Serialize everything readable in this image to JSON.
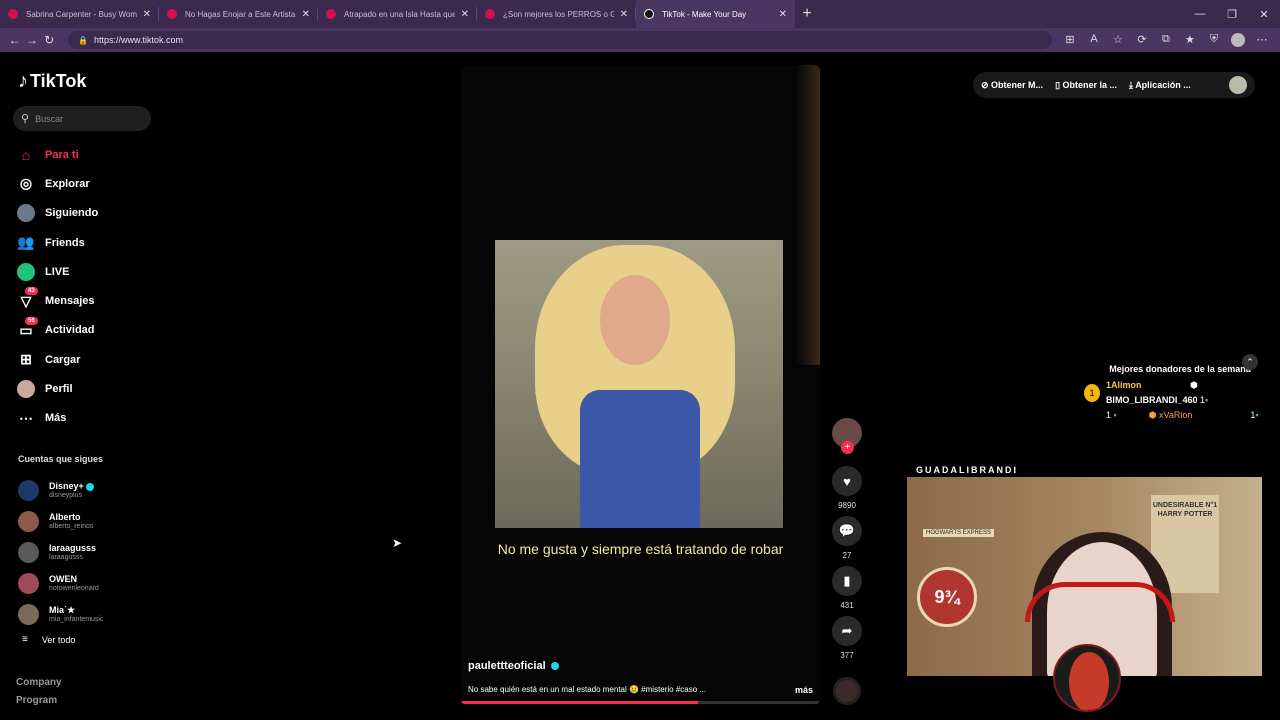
{
  "browser": {
    "tabs": [
      {
        "title": "Sabrina Carpenter - Busy Woman",
        "active": false
      },
      {
        "title": "No Hagas Enojar a Este Artista - Y",
        "active": false
      },
      {
        "title": "Atrapado en una Isla Hasta que Co",
        "active": false
      },
      {
        "title": "¿Son mejores los PERROS o GATO",
        "active": false
      },
      {
        "title": "TikTok - Make Your Day",
        "active": true
      }
    ],
    "url": "https://www.tiktok.com"
  },
  "sidebar": {
    "logo": "TikTok",
    "search_placeholder": "Buscar",
    "items": [
      {
        "label": "Para ti",
        "icon": "home-icon",
        "active": true
      },
      {
        "label": "Explorar",
        "icon": "compass-icon"
      },
      {
        "label": "Siguiendo",
        "icon": "following-avatar-icon"
      },
      {
        "label": "Friends",
        "icon": "friends-icon"
      },
      {
        "label": "LIVE",
        "icon": "live-icon"
      },
      {
        "label": "Mensajes",
        "icon": "message-icon",
        "badge": "43"
      },
      {
        "label": "Actividad",
        "icon": "activity-icon",
        "badge": "56"
      },
      {
        "label": "Cargar",
        "icon": "upload-icon"
      },
      {
        "label": "Perfil",
        "icon": "profile-avatar-icon"
      },
      {
        "label": "Más",
        "icon": "more-icon"
      }
    ],
    "following_title": "Cuentas que sigues",
    "following": [
      {
        "name": "Disney+",
        "handle": "disneyplus",
        "verified": true
      },
      {
        "name": "Alberto",
        "handle": "alberto_reinos"
      },
      {
        "name": "laraagusss",
        "handle": "laraagusss"
      },
      {
        "name": "OWEN",
        "handle": "notowenleonard"
      },
      {
        "name": "Mia˙★",
        "handle": "mia_infantemusic"
      }
    ],
    "see_all": "Ver todo",
    "footer": [
      "Company",
      "Program"
    ]
  },
  "topbar": {
    "items": [
      "Obtener M...",
      "Obtener la ...",
      "Aplicación ..."
    ]
  },
  "video": {
    "caption": "No me gusta y siempre está tratando de robar",
    "author": "paulettteoficial",
    "description": "No sabe quién está en un mal estado mental 😢 #misterio #caso ...",
    "more": "más",
    "progress": 0.66
  },
  "actions": {
    "likes": "9890",
    "comments": "27",
    "saves": "431",
    "shares": "377"
  },
  "overlay": {
    "donors_title": "Mejores donadores de la semana",
    "medal": "1",
    "donors": [
      {
        "name": "1Alimon",
        "count": "1"
      },
      {
        "name": "BIMO_LIBRANDI_460",
        "count": "1"
      },
      {
        "name": "xVaRion",
        "count": "1"
      }
    ],
    "stream_name": "GUADALIBRANDI",
    "poster_text": "UNDESIRABLE N°1 HARRY POTTER",
    "platform_text": "9¾",
    "hogwarts_text": "HOGWARTS EXPRESS"
  }
}
